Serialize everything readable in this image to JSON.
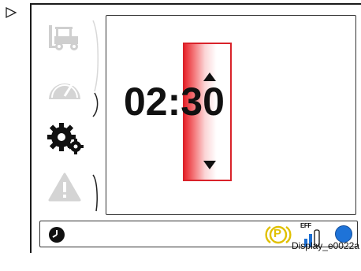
{
  "main": {
    "time": {
      "hours": "02",
      "separator": ":",
      "minutes": "30"
    }
  },
  "status": {
    "parking_brake_letter": "P",
    "eff_label": "EFF"
  },
  "footer": {
    "caption": "Display_e0022a"
  },
  "sidebar": {
    "items": [
      {
        "icon": "forklift-icon",
        "active": false
      },
      {
        "icon": "speed-dial-icon",
        "active": false
      },
      {
        "icon": "gears-settings-icon",
        "active": true
      },
      {
        "icon": "warning-icon",
        "active": false
      }
    ]
  },
  "colors": {
    "selector_border": "#d9222a",
    "parking_brake": "#e0c000",
    "status_dot": "#1e73d8",
    "eff_bar_fill": "#1e6fd2",
    "inactive_icon": "#cfcfcf"
  }
}
